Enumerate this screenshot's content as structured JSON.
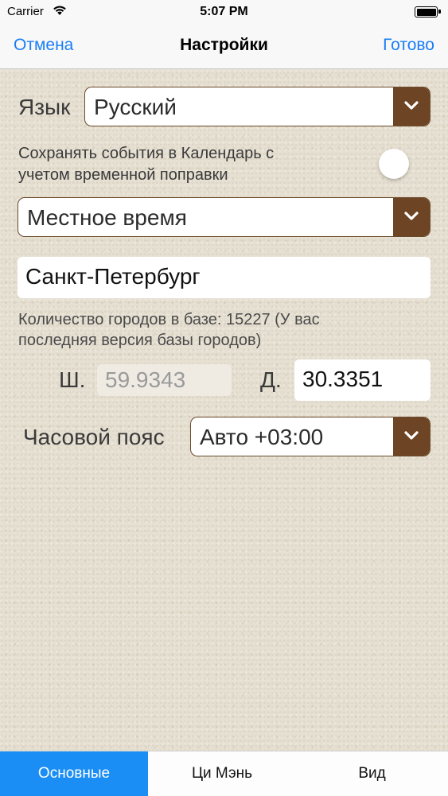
{
  "status_bar": {
    "carrier": "Carrier",
    "time": "5:07 PM"
  },
  "nav": {
    "cancel": "Отмена",
    "title": "Настройки",
    "done": "Готово"
  },
  "language": {
    "label": "Язык",
    "value": "Русский"
  },
  "calendar_option": {
    "text_line1": "Сохранять события в Календарь с",
    "text_line2": "учетом временной поправки",
    "enabled": false
  },
  "time_mode": {
    "value": "Местное время"
  },
  "city": {
    "value": "Санкт-Петербург"
  },
  "cities_info": {
    "line1": "Количество городов в базе: 15227 (У вас",
    "line2": "последняя версия базы городов)"
  },
  "coords": {
    "lat_label": "Ш.",
    "lat_value": "59.9343",
    "lon_label": "Д.",
    "lon_value": "30.3351"
  },
  "timezone": {
    "label": "Часовой пояс",
    "value": "Авто +03:00"
  },
  "tabs": [
    {
      "label": "Основные",
      "active": true
    },
    {
      "label": "Ци Мэнь",
      "active": false
    },
    {
      "label": "Вид",
      "active": false
    }
  ],
  "colors": {
    "accent": "#1a7ef7",
    "dropdown_button": "#6e4524",
    "active_tab": "#1a8ef5"
  },
  "icons": {
    "dropdown": "chevron-down-icon",
    "wifi": "wifi-icon",
    "battery": "battery-icon"
  }
}
